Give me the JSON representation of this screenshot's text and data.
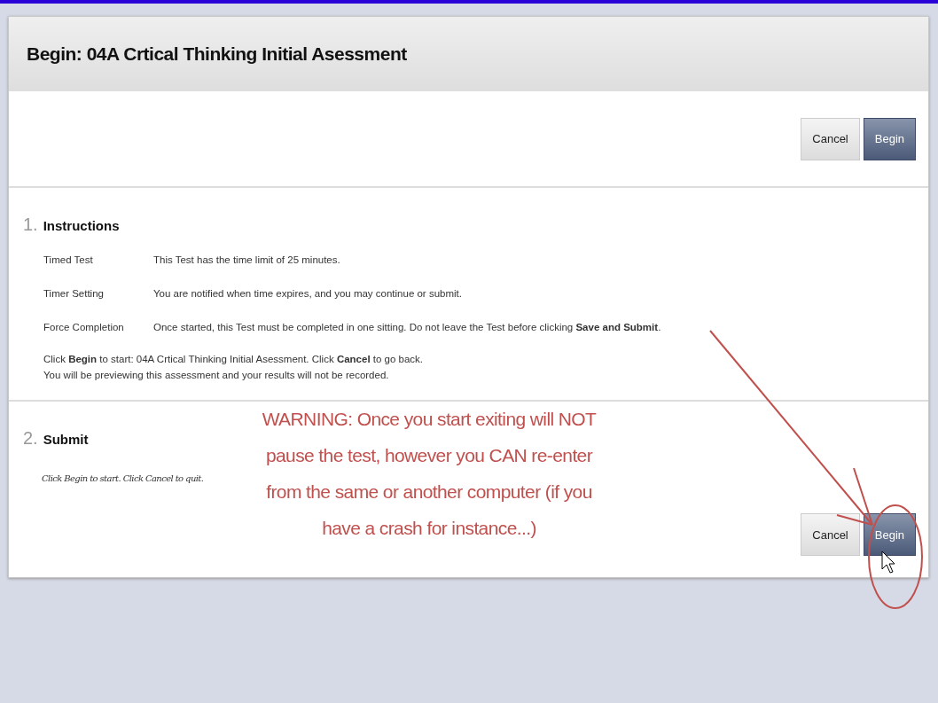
{
  "page_title": "Begin: 04A Crtical Thinking Initial Asessment",
  "top_buttons": [
    {
      "label": "Cancel",
      "kind": "secondary"
    },
    {
      "label": "Begin",
      "kind": "primary"
    }
  ],
  "instructions": {
    "number": "1.",
    "title": "Instructions",
    "rows": [
      {
        "label": "Timed Test",
        "value": "This Test has the time limit of 25 minutes."
      },
      {
        "label": "Timer Setting",
        "value": "You are notified when time expires, and you may continue or submit."
      },
      {
        "label": "Force Completion",
        "value": "Once started, this Test must be completed in one sitting. Do not leave the Test before clicking **Save and Submit**."
      }
    ],
    "notes": [
      "Click **Begin** to start: 04A Crtical Thinking Initial Asessment. Click **Cancel** to go back.",
      "You will be previewing this assessment and your results will not be recorded."
    ]
  },
  "submit": {
    "number": "2.",
    "title": "Submit",
    "note": "Click Begin to start. Click Cancel to quit.",
    "buttons": [
      {
        "label": "Cancel",
        "kind": "secondary"
      },
      {
        "label": "Begin",
        "kind": "primary"
      }
    ]
  },
  "annotation": {
    "warning": "WARNING: Once you start exiting will NOT pause the test, however you CAN re-enter from the same or another computer (if you have a crash for instance...)"
  }
}
